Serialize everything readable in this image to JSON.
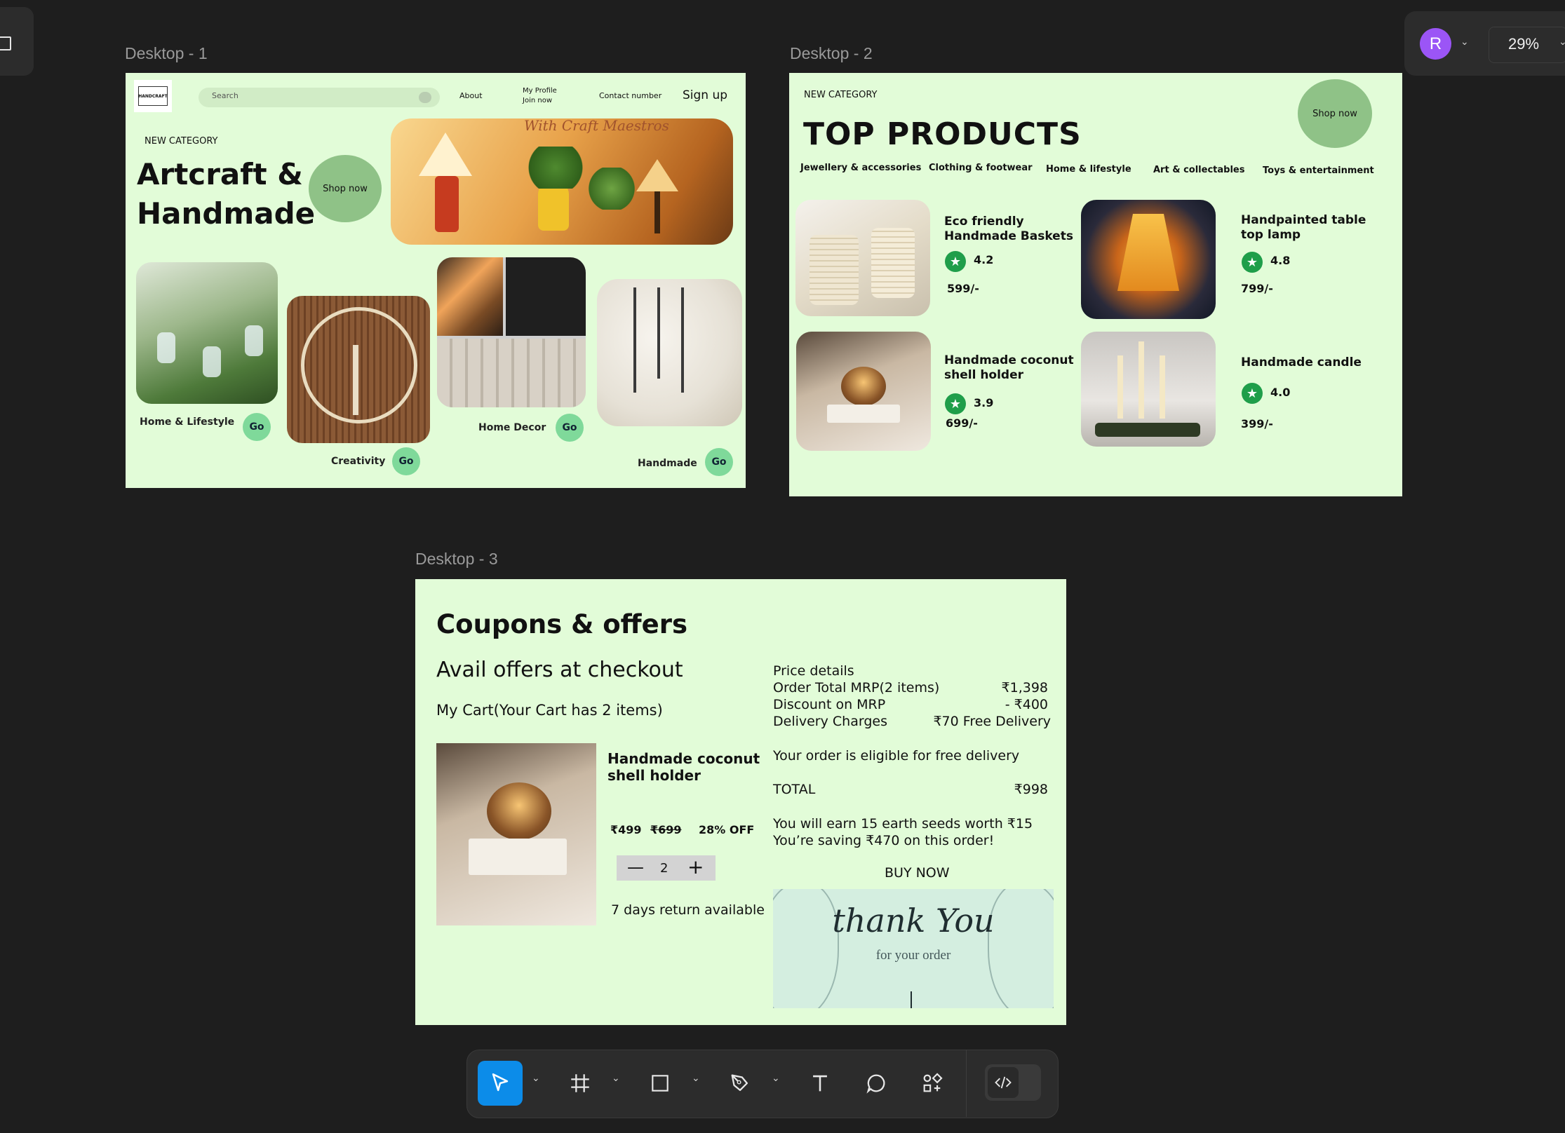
{
  "app": {
    "zoom": "29%",
    "avatar_letter": "R"
  },
  "frames": {
    "d1": {
      "label": "Desktop - 1"
    },
    "d2": {
      "label": "Desktop - 2"
    },
    "d3": {
      "label": "Desktop - 3"
    }
  },
  "d1": {
    "logo_text": "HANDCRAFT",
    "search_placeholder": "Search",
    "nav": {
      "about": "About",
      "profile": "My Profile",
      "join": "Join now",
      "contact": "Contact number",
      "signup": "Sign up"
    },
    "eyebrow": "NEW CATEGORY",
    "hero_line1": "Artcraft &",
    "hero_line2": "Handmade",
    "shop_now": "Shop now",
    "banner_script": "With Craft Maestros",
    "cards": [
      {
        "label": "Home & Lifestyle",
        "go": "Go"
      },
      {
        "label": "Creativity",
        "go": "Go"
      },
      {
        "label": "Home Decor",
        "go": "Go"
      },
      {
        "label": "Handmade",
        "go": "Go"
      }
    ]
  },
  "d2": {
    "eyebrow": "NEW CATEGORY",
    "title": "TOP PRODUCTS",
    "shop_now": "Shop now",
    "categories": [
      "Jewellery & accessories",
      "Clothing & footwear",
      "Home & lifestyle",
      "Art & collectables",
      "Toys & entertainment"
    ],
    "products": [
      {
        "name1": "Eco friendly",
        "name2": "Handmade Baskets",
        "rating": "4.2",
        "price": "599/-"
      },
      {
        "name1": "Handpainted table",
        "name2": "top lamp",
        "rating": "4.8",
        "price": "799/-"
      },
      {
        "name1": "Handmade coconut",
        "name2": "shell holder",
        "rating": "3.9",
        "price": "699/-"
      },
      {
        "name1": "Handmade candle",
        "name2": "",
        "rating": "4.0",
        "price": "399/-"
      }
    ]
  },
  "d3": {
    "title": "Coupons & offers",
    "subtitle": "Avail offers at checkout",
    "cart_note": "My Cart(Your Cart has 2 items)",
    "item_name1": "Handmade coconut",
    "item_name2": "shell holder",
    "price_now": "₹499",
    "price_was": "₹699",
    "discount": "28% OFF",
    "qty": "2",
    "return_note": "7 days return available",
    "price_details_heading": "Price details",
    "rows": [
      {
        "label": "Order Total MRP(2 items)",
        "value": "₹1,398"
      },
      {
        "label": "Discount on MRP",
        "value": "- ₹400"
      },
      {
        "label": "Delivery Charges",
        "value": "₹70 Free Delivery"
      }
    ],
    "eligible": "Your order is eligible for free delivery",
    "total_label": "TOTAL",
    "total_value": "₹998",
    "seeds": "You will earn 15 earth seeds worth ₹15",
    "saving": "You’re saving ₹470 on this order!",
    "buy_now": "BUY NOW",
    "thanks_title": "thank You",
    "thanks_sub": "for your order"
  },
  "toolbar": {
    "tools": [
      "move-tool",
      "frame-tool",
      "shape-tool",
      "pen-tool",
      "text-tool",
      "comment-tool",
      "resources-tool",
      "dev-mode-toggle"
    ]
  },
  "colors": {
    "canvas": "#1e1e1e",
    "frame_bg": "#e2fcd8",
    "accent": "#0c8ce9",
    "go_button": "#7fd99a",
    "shop_now": "#8fc287",
    "star": "#1f9e4a"
  }
}
